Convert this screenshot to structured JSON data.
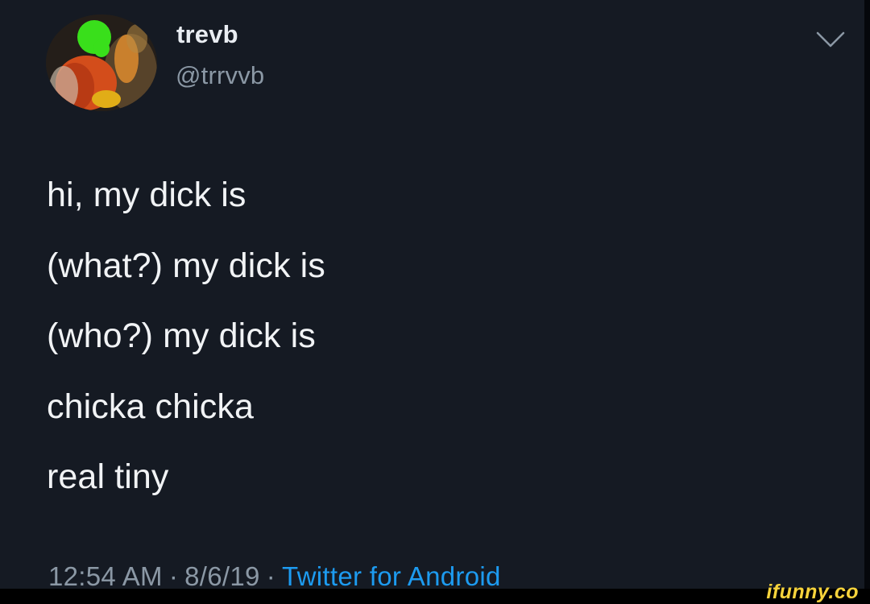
{
  "tweet": {
    "display_name": "trevb",
    "handle": "@trrvvb",
    "lines": [
      "hi, my dick is",
      "(what?) my dick is",
      "(who?) my dick is",
      "chicka chicka",
      "real tiny"
    ],
    "time": "12:54 AM",
    "date": "8/6/19",
    "separator": "·",
    "source": "Twitter for Android"
  },
  "watermark": {
    "text": "ifunny.co"
  },
  "icons": {
    "avatar": "profile-photo",
    "menu": "chevron-down-icon"
  },
  "colors": {
    "background": "#151a23",
    "primary_text": "#f1f3f5",
    "secondary_text": "#8b98a5",
    "link": "#1d9bf0",
    "watermark": "#f7d33b"
  }
}
